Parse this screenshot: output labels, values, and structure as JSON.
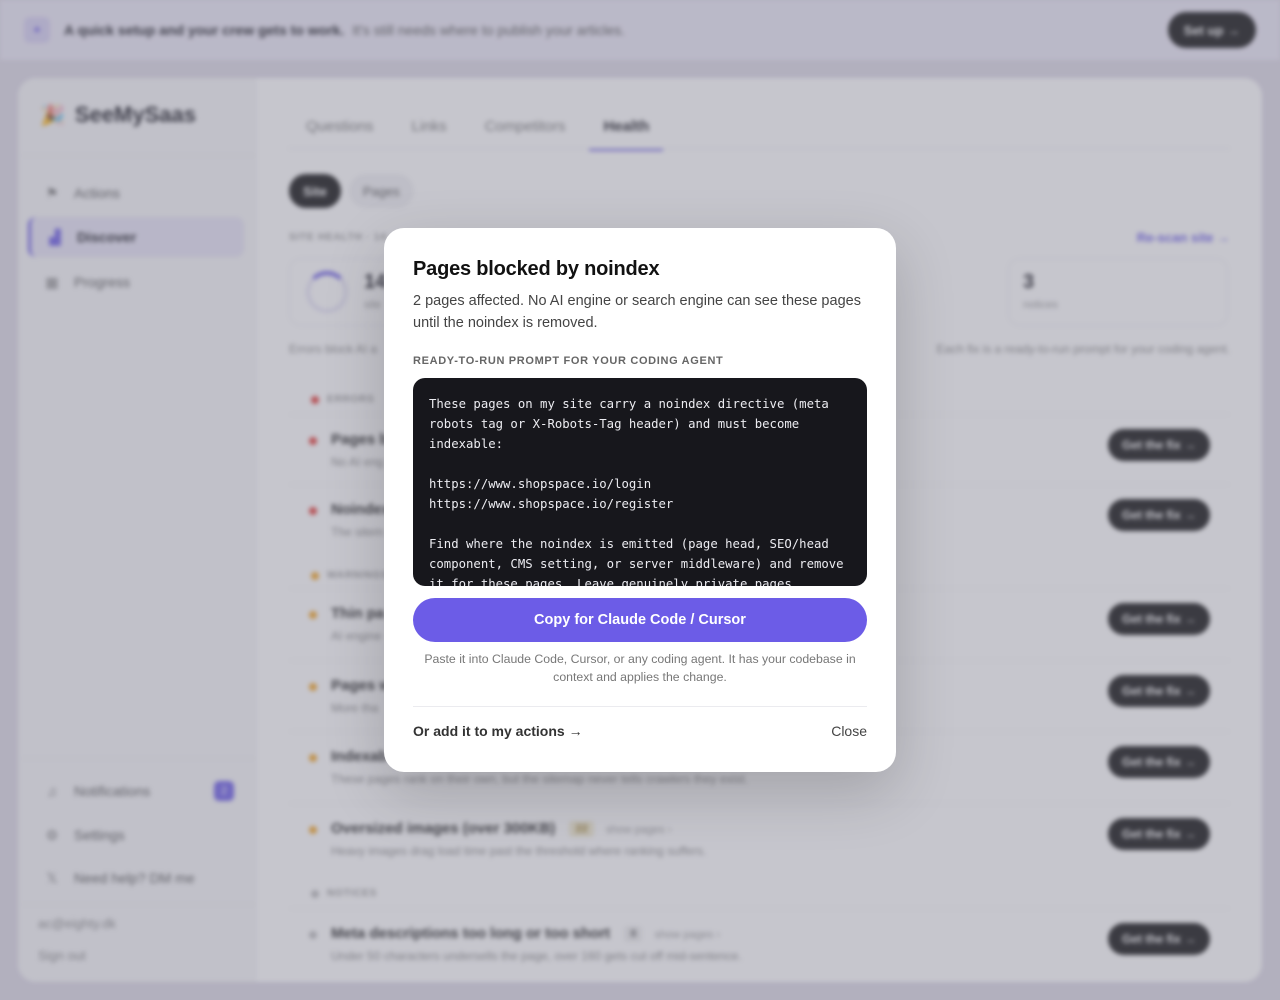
{
  "banner": {
    "icon": "sparkle-icon",
    "bold": "A quick setup and your crew gets to work.",
    "text": "It's still needs where to publish your articles.",
    "button": "Set up →"
  },
  "sidebar": {
    "brand": "SeeMySaas",
    "items": [
      {
        "label": "Actions",
        "icon": "flag-icon"
      },
      {
        "label": "Discover",
        "icon": "chart-icon"
      },
      {
        "label": "Progress",
        "icon": "calendar-icon"
      }
    ],
    "footer_items": [
      {
        "label": "Notifications",
        "icon": "bell-icon",
        "badge": "2"
      },
      {
        "label": "Settings",
        "icon": "gear-icon"
      },
      {
        "label": "Need help? DM me",
        "icon": "x-icon"
      }
    ],
    "email": "ac@eighty.dk",
    "signout": "Sign out"
  },
  "tabs": [
    "Questions",
    "Links",
    "Competitors",
    "Health"
  ],
  "pills": [
    "Site",
    "Pages"
  ],
  "section_caption": "SITE HEALTH · 14",
  "rescan": "Re-scan site →",
  "stats": [
    {
      "num": "14",
      "label": "site"
    },
    {
      "num": "3",
      "label": "notices"
    }
  ],
  "intro_left": "Errors block AI a",
  "intro_right": "Each fix is a ready-to-run prompt for your coding agent.",
  "groups": {
    "errors": "ERRORS",
    "warnings": "WARNINGS",
    "notices": "NOTICES"
  },
  "issues": [
    {
      "title": "Pages b",
      "desc": "No AI eng",
      "color": "#e53935"
    },
    {
      "title": "Noindex",
      "desc": "The sitem",
      "color": "#e53935"
    },
    {
      "title": "Thin pa",
      "desc": "AI engine",
      "color": "#f5a623"
    },
    {
      "title": "Pages w",
      "desc": "More tha",
      "color": "#f5a623"
    },
    {
      "title": "Indexab",
      "desc": "These pages rank on their own, but the sitemap never tells crawlers they exist.",
      "color": "#f5a623"
    },
    {
      "title": "Oversized images (over 300KB)",
      "count": "22",
      "show": "show pages ›",
      "desc": "Heavy images drag load time past the threshold where ranking suffers.",
      "color": "#f5a623"
    },
    {
      "title": "Meta descriptions too long or too short",
      "count": "8",
      "show": "show pages ›",
      "desc": "Under 50 characters undersells the page, over 160 gets cut off mid-sentence.",
      "color": "#bbbbbb"
    }
  ],
  "fix_label": "Get the fix →",
  "modal": {
    "title": "Pages blocked by noindex",
    "subtitle": "2 pages affected. No AI engine or search engine can see these pages until the noindex is removed.",
    "caption": "READY-TO-RUN PROMPT FOR YOUR CODING AGENT",
    "code": "These pages on my site carry a noindex directive (meta\nrobots tag or X-Robots-Tag header) and must become\nindexable:\n\nhttps://www.shopspace.io/login\nhttps://www.shopspace.io/register\n\nFind where the noindex is emitted (page head, SEO/head\ncomponent, CMS setting, or server middleware) and remove\nit for these pages. Leave genuinely private pages",
    "copy_button": "Copy for Claude Code / Cursor",
    "hint": "Paste it into Claude Code, Cursor, or any coding agent. It has your codebase in context and applies the change.",
    "add_link": "Or add it to my actions →",
    "close": "Close"
  }
}
